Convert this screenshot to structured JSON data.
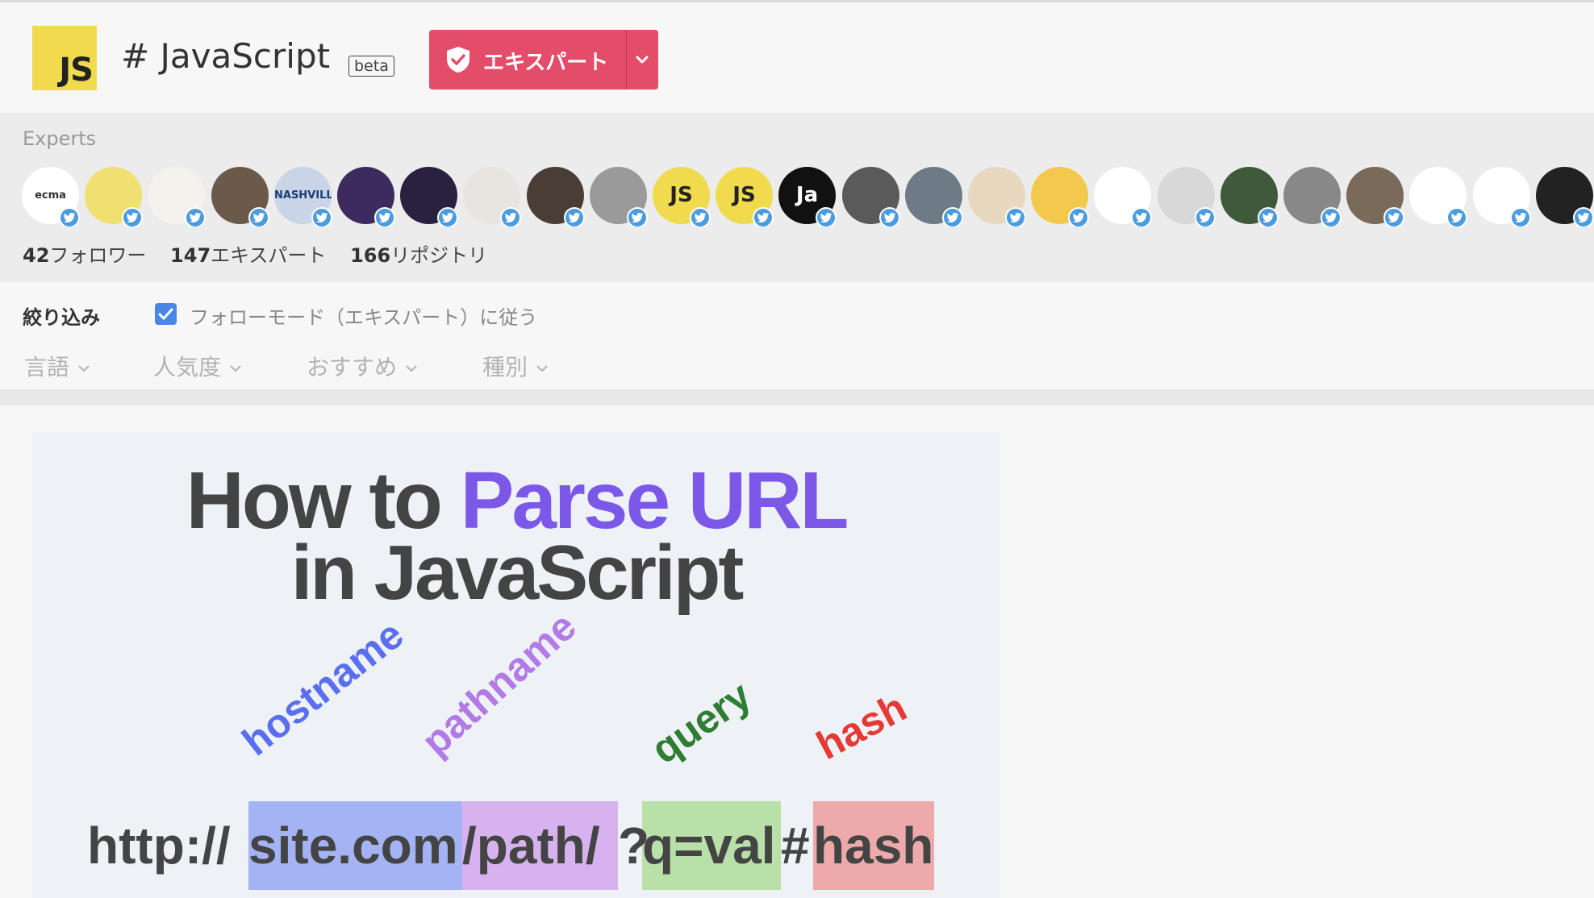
{
  "header": {
    "logo_text": "JS",
    "tag_title": "# JavaScript",
    "beta_label": "beta",
    "expert_button_label": "エキスパート",
    "brand_color": "#e44d6a",
    "logo_color": "#f0db4f"
  },
  "experts": {
    "label": "Experts",
    "avatars": [
      {
        "name": "ecma",
        "text": "ecma",
        "bg": "#ffffff",
        "fg": "#333333"
      },
      {
        "name": "yellow",
        "text": "",
        "bg": "#f0e071",
        "fg": "#333333"
      },
      {
        "name": "bearded-cartoon",
        "text": "",
        "bg": "#f5f2ee",
        "fg": "#333333"
      },
      {
        "name": "group-photo",
        "text": "",
        "bg": "#6b5a4a",
        "fg": "#ffffff"
      },
      {
        "name": "nashville",
        "text": "NASHVILLE",
        "bg": "#c9d5e6",
        "fg": "#1a3a7a"
      },
      {
        "name": "purple-photo",
        "text": "",
        "bg": "#3d2a5e",
        "fg": "#ffffff"
      },
      {
        "name": "dark-photo",
        "text": "",
        "bg": "#2a2140",
        "fg": "#ffffff"
      },
      {
        "name": "gray-hair",
        "text": "",
        "bg": "#e8e4e0",
        "fg": "#333333"
      },
      {
        "name": "woman-photo",
        "text": "",
        "bg": "#4a3d35",
        "fg": "#ffffff"
      },
      {
        "name": "glasses-photo",
        "text": "",
        "bg": "#9a9a9a",
        "fg": "#ffffff"
      },
      {
        "name": "js-yellow",
        "text": "JS",
        "bg": "#f0db4f",
        "fg": "#222222"
      },
      {
        "name": "js-daily",
        "text": "JS",
        "bg": "#f0db4f",
        "fg": "#222222"
      },
      {
        "name": "ja-black",
        "text": "Ja",
        "bg": "#111111",
        "fg": "#ffffff"
      },
      {
        "name": "street-photo",
        "text": "",
        "bg": "#5a5a5a",
        "fg": "#ffffff"
      },
      {
        "name": "office-photo",
        "text": "",
        "bg": "#6e7a86",
        "fg": "#ffffff"
      },
      {
        "name": "dog-photo",
        "text": "",
        "bg": "#e8d8c0",
        "fg": "#333333"
      },
      {
        "name": "blue-face",
        "text": "",
        "bg": "#f2c94c",
        "fg": "#2f80ed"
      },
      {
        "name": "green-smile",
        "text": "",
        "bg": "#ffffff",
        "fg": "#333333"
      },
      {
        "name": "hoodie-photo",
        "text": "",
        "bg": "#d8d8d8",
        "fg": "#333333"
      },
      {
        "name": "outdoor-photo",
        "text": "",
        "bg": "#3f5a3a",
        "fg": "#ffffff"
      },
      {
        "name": "headphones-photo",
        "text": "",
        "bg": "#888888",
        "fg": "#ffffff"
      },
      {
        "name": "sunglasses-photo",
        "text": "",
        "bg": "#7a6a5a",
        "fg": "#ffffff"
      },
      {
        "name": "shiba-cartoon",
        "text": "",
        "bg": "#ffffff",
        "fg": "#c8874a"
      },
      {
        "name": "robot-cartoon",
        "text": "",
        "bg": "#ffffff",
        "fg": "#3cb371"
      },
      {
        "name": "dark-portrait",
        "text": "",
        "bg": "#222222",
        "fg": "#ffffff"
      }
    ],
    "stats": [
      {
        "value": "42",
        "label": "フォロワー"
      },
      {
        "value": "147",
        "label": "エキスパート"
      },
      {
        "value": "166",
        "label": "リポジトリ"
      }
    ]
  },
  "filter": {
    "label": "絞り込み",
    "follow_mode_label": "フォローモード（エキスパート）に従う",
    "follow_mode_checked": true,
    "dropdowns": [
      {
        "name": "language",
        "label": "言語"
      },
      {
        "name": "popularity",
        "label": "人気度"
      },
      {
        "name": "recommended",
        "label": "おすすめ"
      },
      {
        "name": "type",
        "label": "種別"
      }
    ]
  },
  "article": {
    "image": {
      "title_line1_prefix": "How to ",
      "title_line1_highlight": "Parse URL",
      "title_line2": "in JavaScript",
      "parts": [
        {
          "name": "hostname",
          "label": "hostname",
          "color": "#5a6ff0"
        },
        {
          "name": "pathname",
          "label": "pathname",
          "color": "#b27ae6"
        },
        {
          "name": "query",
          "label": "query",
          "color": "#2e7d32"
        },
        {
          "name": "hash",
          "label": "hash",
          "color": "#e53935"
        }
      ],
      "url": {
        "protocol": "http://",
        "host": "site.com",
        "path": "/path/",
        "qmark": "?",
        "query": "q=val",
        "hashmark": "#",
        "hash": "hash"
      },
      "highlight_colors": {
        "host": "#a3b3f3",
        "path": "#d6b3ee",
        "query": "#b8e0a8",
        "hash": "#eeaaaa"
      }
    }
  }
}
